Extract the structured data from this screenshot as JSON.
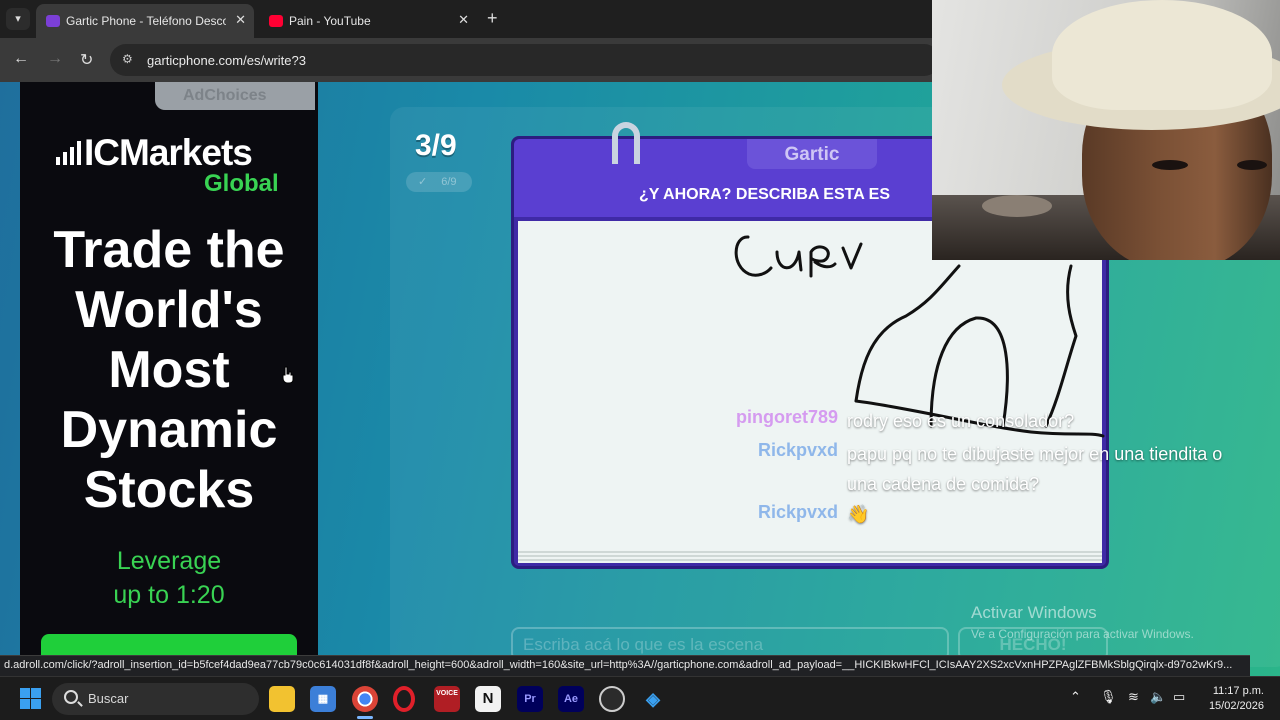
{
  "browser": {
    "tabs": [
      {
        "label": "Gartic Phone - Teléfono Descon",
        "active": true
      },
      {
        "label": "Pain - YouTube",
        "active": false
      }
    ],
    "new_tab_label": "+",
    "url": "garticphone.com/es/write?3",
    "status_url": "d.adroll.com/click/?adroll_insertion_id=b5fcef4dad9ea77cb79c0c614031df8f&adroll_height=600&adroll_width=160&site_url=http%3A//garticphone.com&adroll_ad_payload=__HICKIBkwHFCl_ICIsAAY2XS2xcVxnHPZPAglZFBMkSblgQirqlx-d97o2wKr9..."
  },
  "ad": {
    "adchoices": "AdChoices",
    "brand": "ICMarkets",
    "brand_sub": "Global",
    "headline": [
      "Trade the",
      "World's",
      "Most",
      "Dynamic",
      "Stocks"
    ],
    "leverage": [
      "Leverage",
      "up to 1:20"
    ]
  },
  "game": {
    "round": "3/9",
    "done_count": "6/9",
    "brand": "Gartic",
    "prompt": "¿Y AHORA? DESCRIBA ESTA ES",
    "input_placeholder": "Escriba acá lo que es la escena",
    "done_button": "HECHO!"
  },
  "chat": [
    {
      "name": "pingoret789",
      "message": "rodry eso es un consolador?",
      "name_color": "#d59bf0"
    },
    {
      "name": "Rickpvxd",
      "message": "papu pq no te dibujaste mejor en una tiendita o",
      "message2": "una cadena de comida?",
      "name_color": "#8fb7ea"
    },
    {
      "name": "Rickpvxd",
      "message": "👋",
      "name_color": "#8fb7ea"
    }
  ],
  "windows_notice": {
    "title": "Activar Windows",
    "subtitle": "Ve a Configuración para activar Windows."
  },
  "taskbar": {
    "search_label": "Buscar",
    "apps": [
      "file-explorer",
      "microsoft-store",
      "chrome",
      "opera",
      "voicemeeter",
      "notion",
      "premiere-pro",
      "after-effects",
      "obs",
      "sourcetree"
    ],
    "time": "11:17 p.m.",
    "date": "15/02/2026"
  }
}
